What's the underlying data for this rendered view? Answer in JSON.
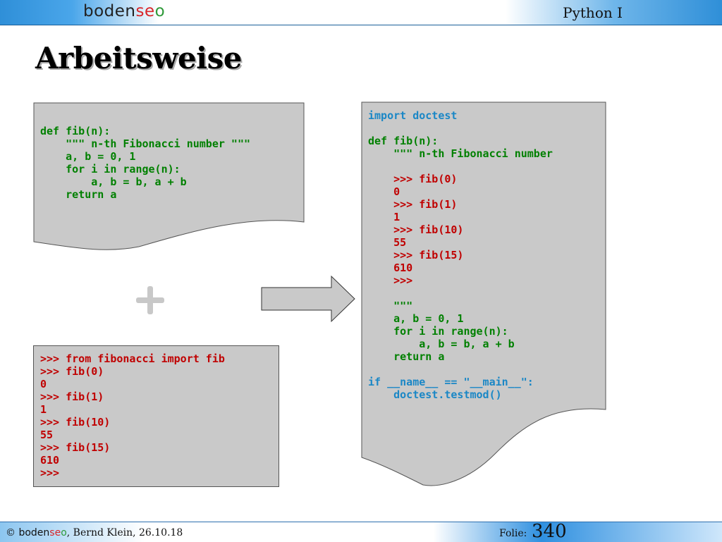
{
  "header": {
    "logo": {
      "part1": "boden",
      "part2": "se",
      "part3": "o"
    },
    "course": "Python I"
  },
  "title": "Arbeitsweise",
  "panels": {
    "left_top": {
      "lines": [
        "def fib(n):",
        "    \"\"\" n-th Fibonacci number \"\"\"",
        "    a, b = 0, 1",
        "    for i in range(n):",
        "        a, b = b, a + b",
        "    return a"
      ]
    },
    "left_bottom": {
      "lines": [
        ">>> from fibonacci import fib",
        ">>> fib(0)",
        "0",
        ">>> fib(1)",
        "1",
        ">>> fib(10)",
        "55",
        ">>> fib(15)",
        "610",
        ">>>"
      ]
    },
    "right": {
      "lines": [
        "import doctest",
        "",
        "def fib(n):",
        "    \"\"\" n-th Fibonacci number",
        "",
        "    >>> fib(0)",
        "    0",
        "    >>> fib(1)",
        "    1",
        "    >>> fib(10)",
        "    55",
        "    >>> fib(15)",
        "    610",
        "    >>>",
        "",
        "    \"\"\"",
        "    a, b = 0, 1",
        "    for i in range(n):",
        "        a, b = b, a + b",
        "    return a",
        "",
        "if __name__ == \"__main__\":",
        "    doctest.testmod()"
      ]
    }
  },
  "symbols": {
    "plus": "+"
  },
  "colors": {
    "code_green": "#008000",
    "code_red": "#c00000",
    "code_blue": "#1a87c6",
    "panel_gray": "#c9c9c9",
    "plus_gray": "#c8c8c8"
  },
  "footer": {
    "copyright_symbol": "©",
    "brand": {
      "part1": "boden",
      "part2": "se",
      "part3": "o"
    },
    "author_date": ", Bernd Klein, 26.10.18",
    "folie_label": "Folie:",
    "slide_number": "340"
  }
}
